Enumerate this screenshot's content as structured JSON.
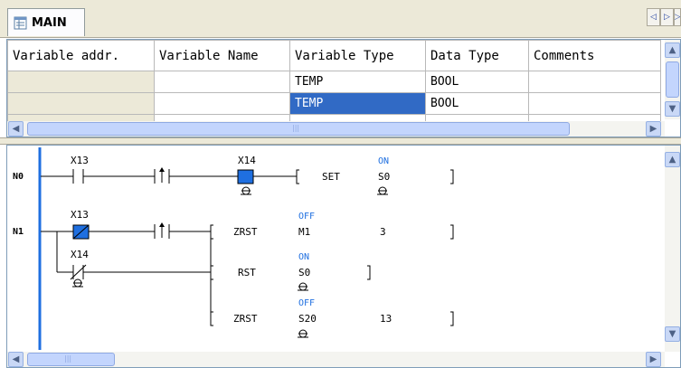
{
  "tabs": [
    {
      "label": "MAIN",
      "active": true
    }
  ],
  "nav": {
    "prev": "◁",
    "next": "▷",
    "more": "▷"
  },
  "variable_grid": {
    "columns": [
      "Variable addr.",
      "Variable Name",
      "Variable Type",
      "Data Type",
      "Comments"
    ],
    "rows": [
      {
        "addr": "",
        "name": "",
        "type": "TEMP",
        "data_type": "BOOL",
        "comments": "",
        "selected": false
      },
      {
        "addr": "",
        "name": "",
        "type": "TEMP",
        "data_type": "BOOL",
        "comments": "",
        "selected": true
      },
      {
        "addr": "",
        "name": "",
        "type": "",
        "data_type": "",
        "comments": "",
        "selected": false
      }
    ]
  },
  "ladder": {
    "rungs": [
      {
        "label": "N0"
      },
      {
        "label": "N1"
      }
    ],
    "contacts": {
      "x13_a": "X13",
      "x14_a": "X14",
      "x13_b": "X13",
      "x14_b": "X14"
    },
    "instructions": {
      "set": {
        "op": "SET",
        "operand": "S0",
        "status": "ON"
      },
      "zrst1": {
        "op": "ZRST",
        "operand": "M1",
        "operand2": "3",
        "status": "OFF"
      },
      "rst": {
        "op": "RST",
        "operand": "S0",
        "status": "ON"
      },
      "zrst2": {
        "op": "ZRST",
        "operand": "S20",
        "operand2": "13",
        "status": "OFF"
      }
    },
    "colors": {
      "active": "#1f6fe0",
      "status_text": "#1f6fe0",
      "rail": "#1f6fe0"
    }
  },
  "scroll": {
    "up": "▲",
    "down": "▼",
    "left": "◀",
    "right": "▶",
    "grip": "|||"
  }
}
